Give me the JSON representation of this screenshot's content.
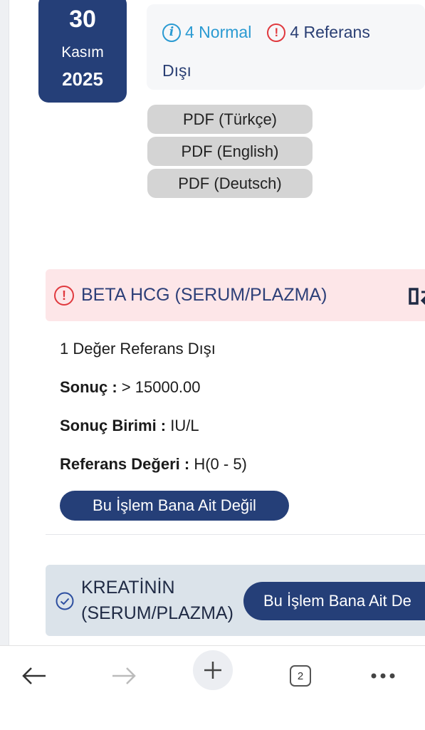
{
  "date": {
    "day": "30",
    "month": "Kasım",
    "year": "2025"
  },
  "summary": {
    "normal_count_label": "4 Normal",
    "abnormal_label_line1": "4 Referans",
    "abnormal_label_line2": "Dışı"
  },
  "pdf_buttons": [
    "PDF (Türkçe)",
    "PDF (English)",
    "PDF (Deutsch)"
  ],
  "beta_hcg": {
    "title": "BETA HCG (SERUM/PLAZMA)",
    "status_text": "1 Değer Referans Dışı",
    "result_label": "Sonuç :",
    "result_value": "> 15000.00",
    "unit_label": "Sonuç Birimi :",
    "unit_value": "IU/L",
    "ref_label": "Referans Değeri :",
    "ref_value": "H(0 - 5)",
    "not_mine_button": "Bu İşlem Bana Ait Değil"
  },
  "kreatinin": {
    "title_line1": "KREATİNİN",
    "title_line2": "(SERUM/PLAZMA)",
    "not_mine_button": "Bu İşlem Bana Ait De"
  },
  "browser_bar": {
    "tab_count": "2"
  },
  "colors": {
    "primary": "#253f78",
    "alert": "#e0393e",
    "info": "#2a9ad2",
    "alert_bg": "#fde6e8",
    "normal_bg": "#dbe3ea"
  }
}
